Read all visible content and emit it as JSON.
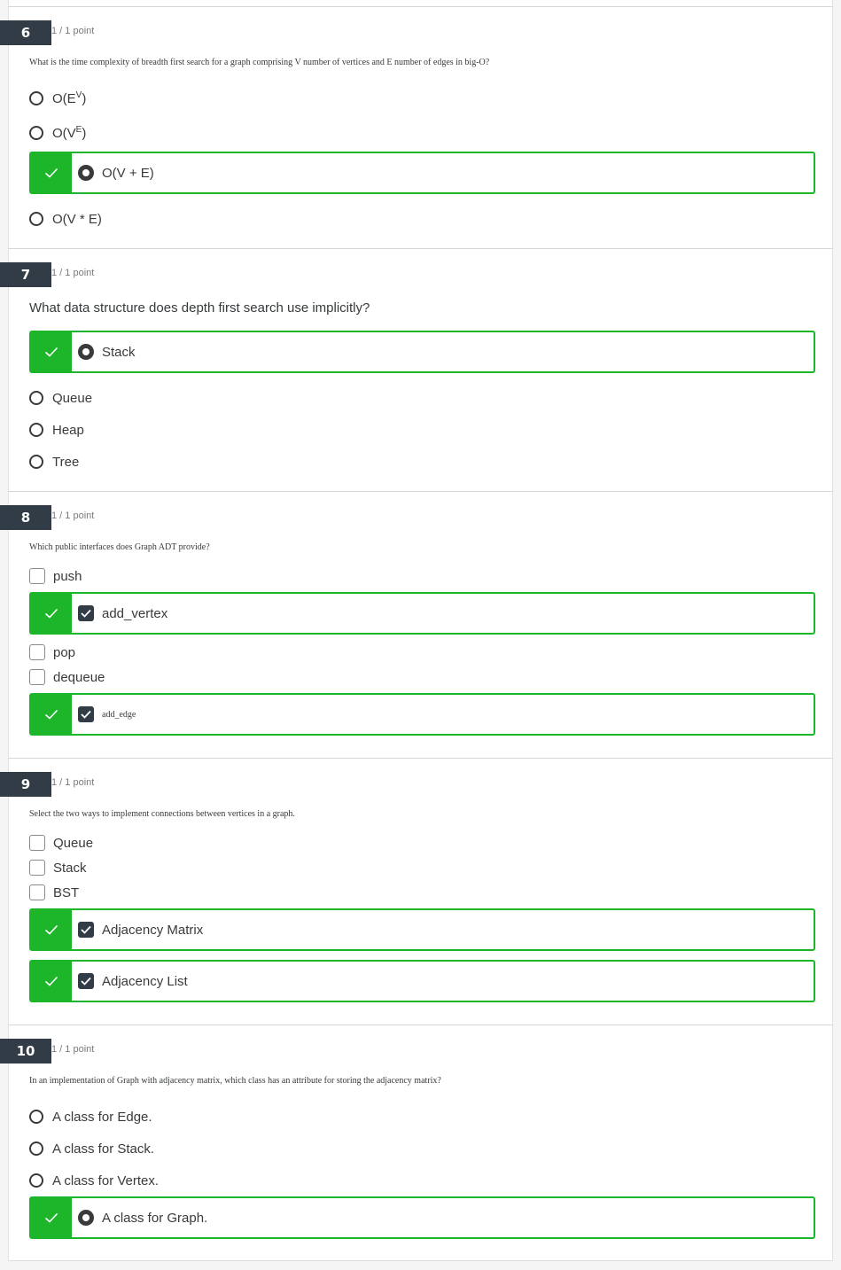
{
  "questions": [
    {
      "number": "6",
      "points": "1 / 1 point",
      "prompt": "What is the time complexity of breadth first search for a graph comprising V number of vertices and E number of edges in big-O?",
      "options": [
        {
          "base": "O(E",
          "sup": "V",
          "tail": ")"
        },
        {
          "base": "O(V",
          "sup": "E",
          "tail": ")"
        },
        {
          "label": "O(V + E)",
          "correct": true
        },
        {
          "label": "O(V * E)"
        }
      ]
    },
    {
      "number": "7",
      "points": "1 / 1 point",
      "prompt": "What data structure does depth first search use implicitly?",
      "options": [
        {
          "label": "Stack",
          "correct": true
        },
        {
          "label": "Queue"
        },
        {
          "label": "Heap"
        },
        {
          "label": "Tree"
        }
      ]
    },
    {
      "number": "8",
      "points": "1 / 1 point",
      "prompt": "Which public interfaces does Graph ADT provide?",
      "options": [
        {
          "label": "push"
        },
        {
          "label": "add_vertex",
          "correct": true
        },
        {
          "label": "pop"
        },
        {
          "label": "dequeue"
        },
        {
          "label": "add_edge",
          "correct": true
        }
      ]
    },
    {
      "number": "9",
      "points": "1 / 1 point",
      "prompt": "Select the two ways to implement connections between vertices in a graph.",
      "options": [
        {
          "label": "Queue"
        },
        {
          "label": "Stack"
        },
        {
          "label": "BST"
        },
        {
          "label": "Adjacency Matrix",
          "correct": true
        },
        {
          "label": "Adjacency List",
          "correct": true
        }
      ]
    },
    {
      "number": "10",
      "points": "1 / 1 point",
      "prompt": "In an implementation of Graph with adjacency matrix, which class has an attribute for storing the adjacency matrix?",
      "options": [
        {
          "label": "A class for Edge."
        },
        {
          "label": "A class for Stack."
        },
        {
          "label": "A class for Vertex."
        },
        {
          "label": "A class for Graph.",
          "correct": true
        }
      ]
    }
  ],
  "colors": {
    "correct": "#1db529",
    "badge": "#323c46"
  },
  "icons": {
    "correct": "check-mark-icon",
    "selected": "radio-selected-icon",
    "checked": "checkbox-checked-icon"
  }
}
